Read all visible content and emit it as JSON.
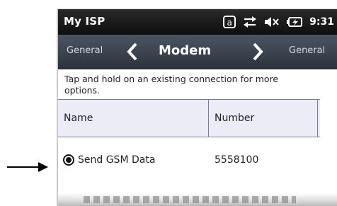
{
  "status_bar": {
    "app_title": "My ISP",
    "icon_letter": "a",
    "icons": [
      "keyboard-a-icon",
      "sync-arrows-icon",
      "speaker-muted-icon",
      "battery-charging-icon"
    ],
    "time": "9:31"
  },
  "nav": {
    "prev_label": "General",
    "title": "Modem",
    "next_label": "General"
  },
  "instructions": "Tap and hold on an existing connection for more options.",
  "table": {
    "columns": [
      "Name",
      "Number"
    ],
    "rows": [
      {
        "name": "Send GSM Data",
        "number": "5558100",
        "selected": true
      }
    ]
  },
  "colors": {
    "status_bar_bg": "#1a1a1a",
    "nav_bar_bg": "#3a424d",
    "header_row_bg": "#ececf6",
    "grid_line": "#7a7a9c"
  }
}
